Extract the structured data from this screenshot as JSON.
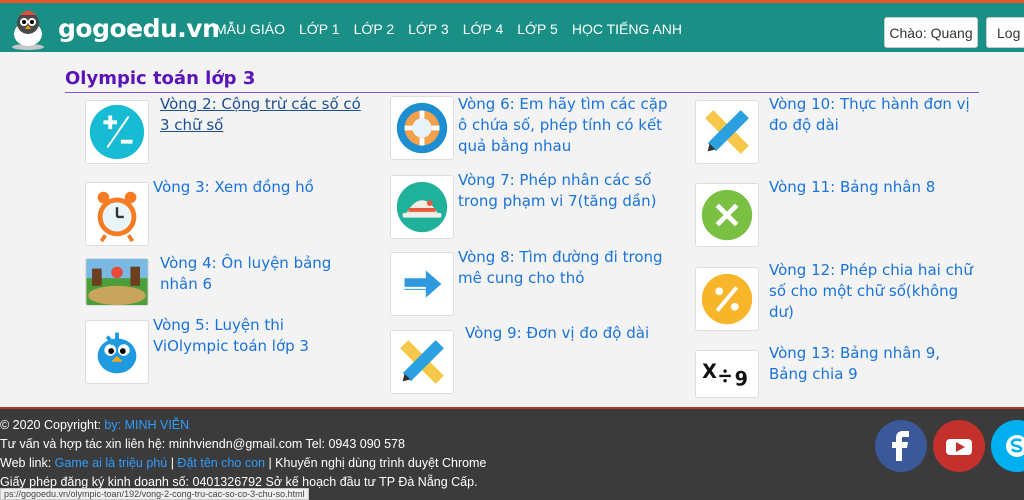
{
  "header": {
    "brand": "gogoedu.vn",
    "nav": [
      "MẪU GIÁO",
      "LỚP 1",
      "LỚP 2",
      "LỚP 3",
      "LỚP 4",
      "LỚP 5",
      "HỌC TIẾNG ANH"
    ],
    "greeting": "Chào: Quang",
    "logout": "Log o"
  },
  "section": {
    "title": "Olympic toán lớp 3"
  },
  "rounds": [
    {
      "label": "Vòng 2: Cộng trừ các số có 3 chữ số",
      "icon": "plus-minus-icon"
    },
    {
      "label": "Vòng 3: Xem đồng hồ",
      "icon": "alarm-clock-icon"
    },
    {
      "label": "Vòng 4: Ôn luyện bảng nhân 6",
      "icon": "game-scene-icon"
    },
    {
      "label": "Vòng 5: Luyện thi ViOlympic toán lớp 3",
      "icon": "blue-bird-icon"
    },
    {
      "label": "Vòng 6: Em hãy tìm các cặp ô chứa số, phép tính có kết quả bằng nhau",
      "icon": "lifebuoy-icon"
    },
    {
      "label": "Vòng 7: Phép nhân các số trong phạm vi 7(tăng dần)",
      "icon": "hat-icon"
    },
    {
      "label": "Vòng 8: Tìm đường đi trong mê cung cho thỏ",
      "icon": "arrow-icon"
    },
    {
      "label": "Vòng 9: Đơn vị đo độ dài",
      "icon": "pencil-ruler-icon"
    },
    {
      "label": "Vòng 10: Thực hành đơn vị đo độ dài",
      "icon": "pencil-ruler-icon"
    },
    {
      "label": "Vòng 11: Bảng nhân 8",
      "icon": "multiply-icon"
    },
    {
      "label": "Vòng 12: Phép chia hai chữ số cho một chữ số(không dư)",
      "icon": "percent-icon"
    },
    {
      "label": "Vòng 13: Bảng nhân 9, Bảng chia 9",
      "icon": "multiply-divide-icon"
    }
  ],
  "footer": {
    "copyright": "© 2020 Copyright: ",
    "author": "by: MINH VIỄN",
    "contact": "Tư vấn và hợp tác xin liên hệ: minhviendn@gmail.com Tel: 0943 090 578",
    "weblink_label": "Web link: ",
    "link1": "Game ai là triệu phú",
    "sep1": " | ",
    "link2": "Đặt tên cho con",
    "recommend": " | Khuyến nghị dùng trình duyệt Chrome",
    "license": "Giấy phép đăng ký kinh doanh số: 0401326792 Sở kế hoạch đầu tư TP Đà Nẵng Cấp."
  },
  "status_url": "ps://gogoedu.vn/olympic-toan/192/vong-2-cong-tru-cac-so-co-3-chu-so.html",
  "colors": {
    "header_bg": "#1a8f85",
    "title": "#5b13b9",
    "link": "#1a73d9",
    "facebook": "#3b5998",
    "youtube": "#c4302b",
    "skype": "#00aff0"
  }
}
